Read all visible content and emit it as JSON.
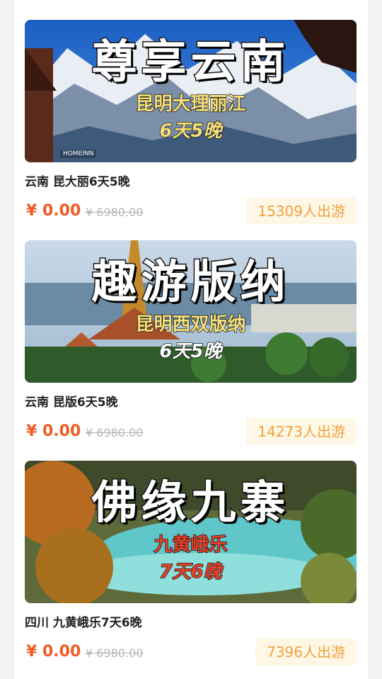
{
  "cards": [
    {
      "banner_title": "尊享云南",
      "banner_sub": "昆明大理丽江",
      "banner_days": "6天5晚",
      "banner_logo": "HOMEINN",
      "title": "云南 昆大丽6天5晚",
      "price": "¥ 0.00",
      "old_price": "¥ 6980.00",
      "sold": "15309人出游"
    },
    {
      "banner_title": "趣游版纳",
      "banner_sub": "昆明西双版纳",
      "banner_days": "6天5晚",
      "title": "云南 昆版6天5晚",
      "price": "¥ 0.00",
      "old_price": "¥ 6980.00",
      "sold": "14273人出游"
    },
    {
      "banner_title": "佛缘九寨",
      "banner_sub": "九黄峨乐",
      "banner_days": "7天6晚",
      "title": "四川 九黄峨乐7天6晚",
      "price": "¥ 0.00",
      "old_price": "¥ 6980.00",
      "sold": "7396人出游"
    }
  ]
}
